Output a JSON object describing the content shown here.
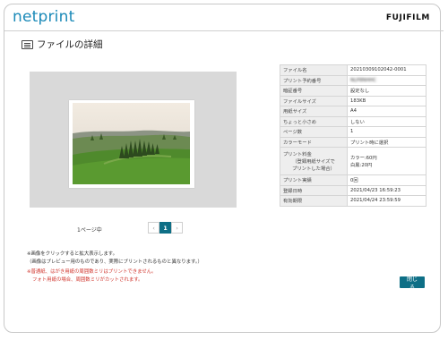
{
  "header": {
    "logo": "netprint",
    "brand": "FUJIFILM"
  },
  "page": {
    "title": "ファイルの詳細",
    "title_icon": "document-list-icon"
  },
  "preview": {
    "pager_label": "1ページ中",
    "prev_symbol": "‹",
    "current_page": "1",
    "next_symbol": "›"
  },
  "details": {
    "rows": [
      {
        "key": "ファイル名",
        "value": "20210309102042-0001"
      },
      {
        "key": "プリント予約番号",
        "value": "NLP8NHHC"
      },
      {
        "key": "暗証番号",
        "value": "設定なし"
      },
      {
        "key": "ファイルサイズ",
        "value": "183KB"
      },
      {
        "key": "用紙サイズ",
        "value": "A4"
      },
      {
        "key": "ちょっと小さめ",
        "value": "しない"
      },
      {
        "key": "ページ数",
        "value": "1"
      },
      {
        "key": "カラーモード",
        "value": "プリント時に選択"
      }
    ],
    "fee": {
      "key_line1": "プリント料金",
      "key_line2": "（登録用紙サイズで",
      "key_line3": "プリントした場合）",
      "value_line1": "カラー:60円",
      "value_line2": "白黒:20円"
    },
    "rows_after": [
      {
        "key": "プリント実績",
        "value": "0回"
      },
      {
        "key": "登録日時",
        "value": "2021/04/23 16:59:23"
      },
      {
        "key": "有効期限",
        "value": "2021/04/24 23:59:59"
      }
    ]
  },
  "notes": {
    "line1": "※画像をクリックすると拡大表示します。",
    "line2": "（画像はプレビュー用のものであり、実際にプリントされるものと異なります。）",
    "warn1": "※普通紙、はがき用紙の周囲数ミリはプリントできません。",
    "warn2": "フォト用紙の場合、周囲数ミリがカットされます。"
  },
  "actions": {
    "close_label": "閉じる"
  },
  "colors": {
    "logo": "#1b8ab8",
    "accent": "#0e6f86",
    "warning": "#d0342c"
  }
}
